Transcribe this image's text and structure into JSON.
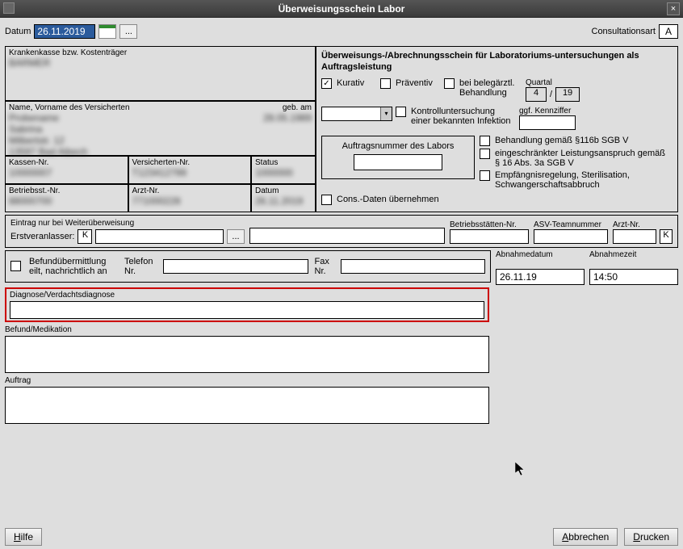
{
  "title": "Überweisungsschein Labor",
  "toolbar": {
    "datum_label": "Datum",
    "datum_value": "26.11.2019",
    "consult_label": "Consultationsart",
    "consult_value": "A"
  },
  "patient": {
    "kasse_label": "Krankenkasse bzw. Kostenträger",
    "name_label": "Name, Vorname des Versicherten",
    "geb_label": "geb. am",
    "kassennr_label": "Kassen-Nr.",
    "versnr_label": "Versicherten-Nr.",
    "status_label": "Status",
    "betriebs_label": "Betriebsst.-Nr.",
    "arztnr_label": "Arzt-Nr.",
    "datum_label": "Datum"
  },
  "right": {
    "heading": "Überweisungs-/Abrechnungsschein für Laboratoriums-untersuchungen als Auftragsleistung",
    "kurativ": "Kurativ",
    "praventiv": "Präventiv",
    "beleg": "bei belegärztl. Behandlung",
    "quartal": "Quartal",
    "q1": "4",
    "qsep": "/",
    "q2": "19",
    "kontroll": "Kontrolluntersuchung einer bekannten Infektion",
    "kennziffer": "ggf. Kennziffer",
    "auftrag_label": "Auftragsnummer des Labors",
    "cons": "Cons.-Daten übernehmen",
    "beh116": "Behandlung gemäß §116b SGB V",
    "einschr": "eingeschränkter Leistungsanspruch gemäß § 16 Abs. 3a SGB V",
    "empf": "Empfängnisregelung, Sterilisation, Schwangerschaftsabbruch"
  },
  "weiter": {
    "title": "Eintrag nur bei Weiterüberweisung",
    "erst": "Erstveranlasser:",
    "k": "K",
    "bstn": "Betriebsstätten-Nr.",
    "asv": "ASV-Teamnummer",
    "arztnr": "Arzt-Nr."
  },
  "befund": {
    "eilt": "Befundübermittlung eilt, nachrichtlich an",
    "tel": "Telefon Nr.",
    "fax": "Fax Nr.",
    "abdat": "Abnahmedatum",
    "abdat_val": "26.11.19",
    "abzt": "Abnahmezeit",
    "abzt_val": "14:50"
  },
  "diag_label": "Diagnose/Verdachtsdiagnose",
  "befmed_label": "Befund/Medikation",
  "auftrag_label": "Auftrag",
  "buttons": {
    "hilfe": "Hilfe",
    "abbrechen": "Abbrechen",
    "drucken": "Drucken"
  }
}
